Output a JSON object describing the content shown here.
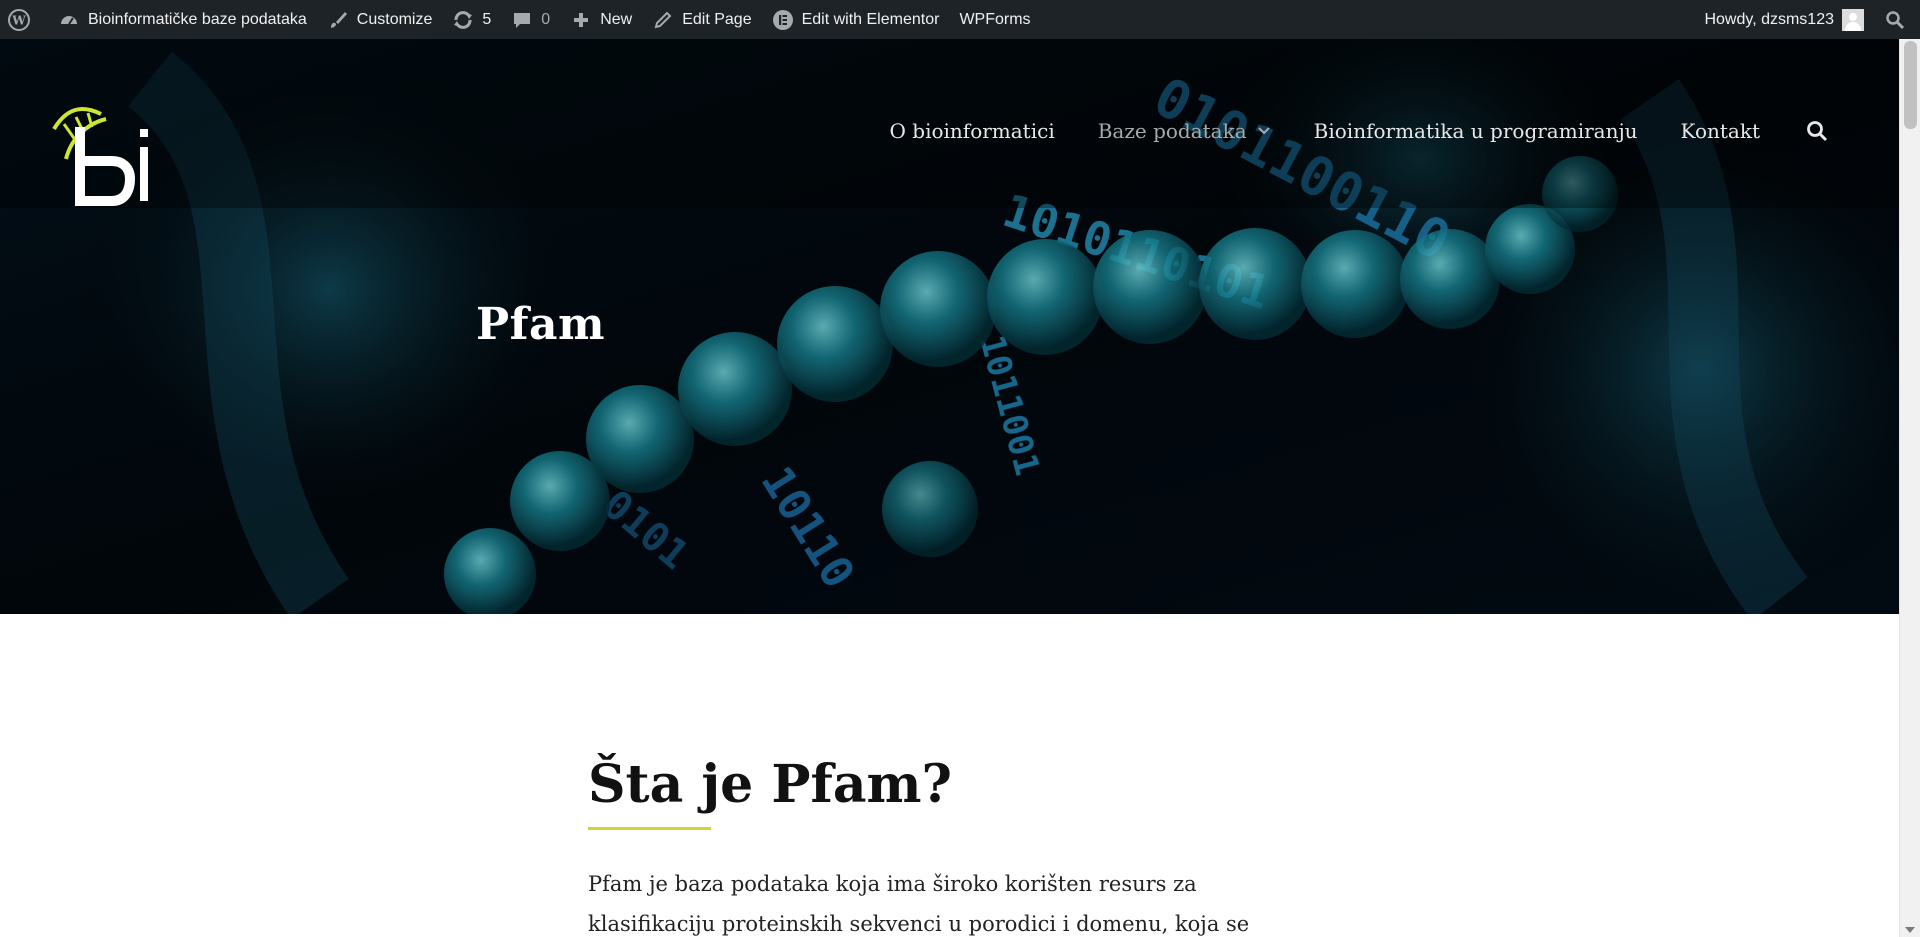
{
  "adminbar": {
    "site_name": "Bioinformatičke baze podataka",
    "customize": "Customize",
    "updates_count": "5",
    "comments_count": "0",
    "new": "New",
    "edit_page": "Edit Page",
    "elementor": "Edit with Elementor",
    "wpforms": "WPForms",
    "howdy": "Howdy, dzsms123"
  },
  "nav": {
    "items": [
      {
        "label": "O bioinformatici"
      },
      {
        "label": "Baze podataka"
      },
      {
        "label": "Bioinformatika u programiranju"
      },
      {
        "label": "Kontakt"
      }
    ]
  },
  "hero": {
    "title": "Pfam"
  },
  "content": {
    "heading": "Šta je Pfam?",
    "paragraph": "Pfam je baza podataka koja ima široko korišten resurs za klasifikaciju proteinskih sekvenci u porodici i domenu, koja se"
  },
  "colors": {
    "admin_bar": "#1d2327",
    "accent": "#d6d62a",
    "hero_teal": "#1fa8b8"
  }
}
